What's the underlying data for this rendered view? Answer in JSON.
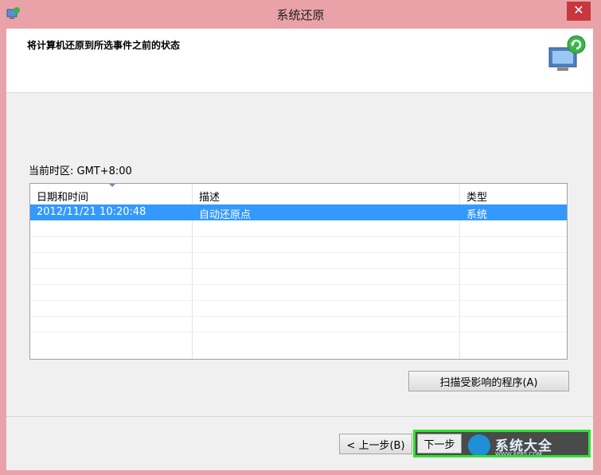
{
  "window": {
    "title": "系统还原",
    "close_label": "✕"
  },
  "header": {
    "heading": "将计算机还原到所选事件之前的状态"
  },
  "timezone_label": "当前时区: GMT+8:00",
  "table": {
    "columns": [
      "日期和时间",
      "描述",
      "类型"
    ],
    "rows": [
      {
        "datetime": "2012/11/21 10:20:48",
        "description": "自动还原点",
        "type": "系统",
        "selected": true
      }
    ]
  },
  "buttons": {
    "scan": "扫描受影响的程序(A)",
    "back": "< 上一步(B)",
    "next": "下一步"
  },
  "watermark": {
    "text": "系统大全",
    "sub": "WWW.XP85.COM"
  },
  "colors": {
    "selection": "#3399ff",
    "highlight": "#31e131",
    "window_frame": "#e9a3a8"
  }
}
